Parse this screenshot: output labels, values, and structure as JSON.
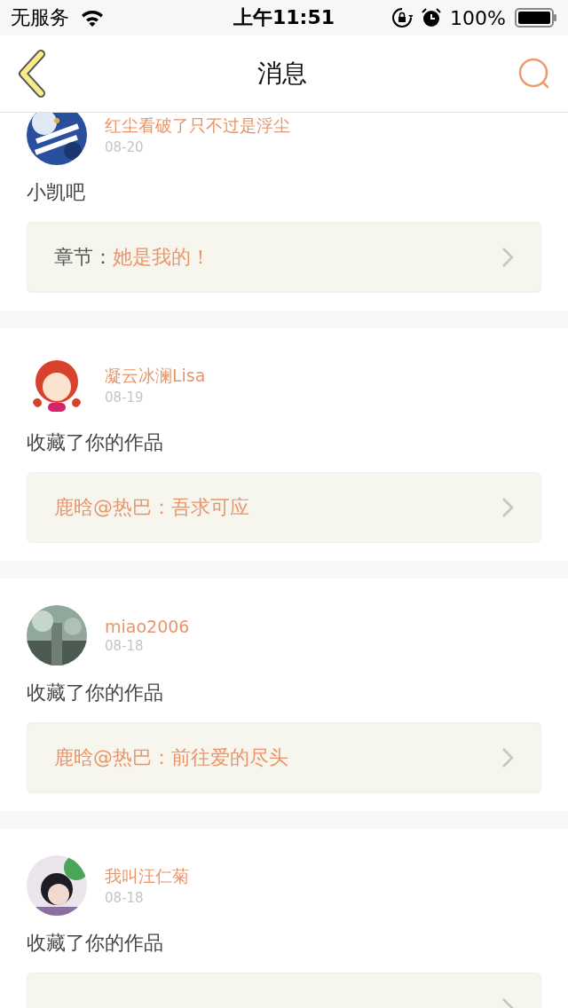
{
  "status_bar": {
    "carrier": "无服务",
    "time": "上午11:51",
    "battery": "100%"
  },
  "nav": {
    "title": "消息"
  },
  "messages": [
    {
      "name": "红尘看破了只不过是浮尘",
      "date": "08-20",
      "text": "小凯吧",
      "quote_label": "章节：",
      "quote_title": "她是我的！"
    },
    {
      "name": "凝云冰澜Lisa",
      "date": "08-19",
      "text": "收藏了你的作品",
      "quote_title": "鹿晗@热巴：吾求可应"
    },
    {
      "name": "miao2006",
      "date": "08-18",
      "text": "收藏了你的作品",
      "quote_title": "鹿晗@热巴：前往爱的尽头"
    },
    {
      "name": "我叫汪仁菊",
      "date": "08-18",
      "text": "收藏了你的作品"
    }
  ]
}
